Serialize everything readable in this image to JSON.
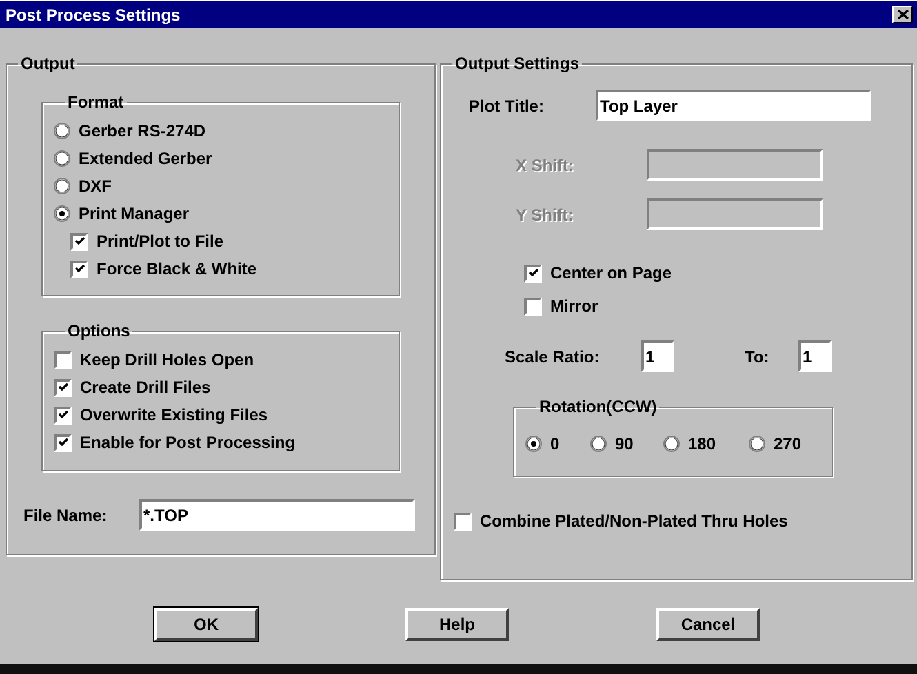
{
  "window": {
    "title": "Post Process Settings"
  },
  "output": {
    "title": "Output",
    "format": {
      "title": "Format",
      "formats": [
        {
          "label": "Gerber RS-274D",
          "selected": false
        },
        {
          "label": "Extended Gerber",
          "selected": false
        },
        {
          "label": "DXF",
          "selected": false
        },
        {
          "label": "Print Manager",
          "selected": true
        }
      ],
      "sub_options": [
        {
          "label": "Print/Plot to File",
          "checked": true
        },
        {
          "label": "Force Black & White",
          "checked": true
        }
      ]
    },
    "options": {
      "title": "Options",
      "items": [
        {
          "label": "Keep Drill Holes Open",
          "checked": false
        },
        {
          "label": "Create Drill Files",
          "checked": true
        },
        {
          "label": "Overwrite Existing Files",
          "checked": true
        },
        {
          "label": "Enable for Post Processing",
          "checked": true
        }
      ]
    },
    "file_name": {
      "label": "File Name:",
      "value": "*.TOP"
    }
  },
  "output_settings": {
    "title": "Output Settings",
    "plot_title": {
      "label": "Plot Title:",
      "value": "Top Layer"
    },
    "shifts": [
      {
        "label": "X Shift:",
        "disabled": true
      },
      {
        "label": "Y Shift:",
        "disabled": true
      }
    ],
    "page_options": [
      {
        "label": "Center on Page",
        "checked": true
      },
      {
        "label": "Mirror",
        "checked": false
      }
    ],
    "scale_ratio": {
      "label": "Scale Ratio:",
      "value": "1"
    },
    "scale_to": {
      "label": "To:",
      "value": "1"
    },
    "rotation": {
      "title": "Rotation(CCW)",
      "options": [
        {
          "label": "0",
          "selected": true
        },
        {
          "label": "90",
          "selected": false
        },
        {
          "label": "180",
          "selected": false
        },
        {
          "label": "270",
          "selected": false
        }
      ]
    },
    "combine": {
      "label": "Combine Plated/Non-Plated Thru Holes",
      "checked": false
    }
  },
  "buttons": [
    {
      "label": "OK",
      "default": true
    },
    {
      "label": "Help",
      "default": false
    },
    {
      "label": "Cancel",
      "default": false
    }
  ]
}
